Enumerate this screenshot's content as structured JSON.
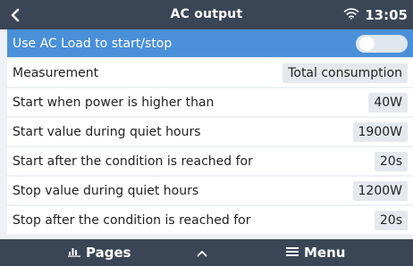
{
  "header": {
    "title": "AC output",
    "time": "13:05",
    "back_icon": "chevron-left-icon",
    "wifi_icon": "wifi-icon"
  },
  "rows": [
    {
      "label": "Use AC Load to start/stop",
      "control": "toggle",
      "toggle_on": false
    },
    {
      "label": "Measurement",
      "value": "Total consumption"
    },
    {
      "label": "Start when power is higher than",
      "value": "40W"
    },
    {
      "label": "Start value during quiet hours",
      "value": "1900W"
    },
    {
      "label": "Start after the condition is reached for",
      "value": "20s"
    },
    {
      "label": "Stop value during quiet hours",
      "value": "1200W"
    },
    {
      "label": "Stop after the condition is reached for",
      "value": "20s"
    }
  ],
  "footer": {
    "pages_label": "Pages",
    "menu_label": "Menu",
    "pages_icon": "bar-chart-icon",
    "up_icon": "chevron-up-icon",
    "menu_icon": "hamburger-icon"
  },
  "colors": {
    "bar_bg": "#3a4656",
    "selected_row": "#4a90d9",
    "screen_bg": "#eef2f6",
    "value_bg": "#e5e9ee"
  }
}
